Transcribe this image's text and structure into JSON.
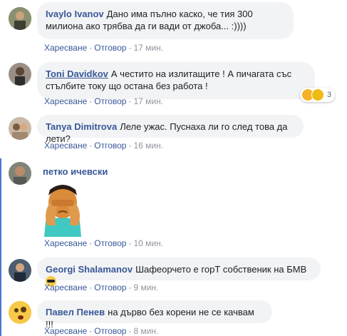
{
  "comments": [
    {
      "author": "Ivaylo Ivanov",
      "text": "Дано има пълно каско, че тия 300 милиона ако трябва да ги вади от джоба... :))))",
      "like": "Харесване",
      "reply": "Отговор",
      "time": "17 мин."
    },
    {
      "author": "Toni Davidkov",
      "text": "А честито на излитащите ! А пичагата със стълбите току що остана без работа !",
      "like": "Харесване",
      "reply": "Отговор",
      "time": "17 мин.",
      "reactions_count": "3"
    },
    {
      "author": "Tanya Dimitrova",
      "text": "Леле ужас. Пуснаха ли го след това да лети?",
      "like": "Харесване",
      "reply": "Отговор",
      "time": "16 мин."
    },
    {
      "author": "петко ичевски",
      "text": "",
      "like": "Харесване",
      "reply": "Отговор",
      "time": "10 мин."
    },
    {
      "author": "Georgi Shalamanov",
      "text": "Шафеорчето е горТ собственик на БМВ",
      "like": "Харесване",
      "reply": "Отговор",
      "time": "9 мин."
    },
    {
      "author": "Павел Пенев",
      "text": "на дърво без корени не се качвам !!!",
      "like": "Харесване",
      "reply": "Отговор",
      "time": "8 мин."
    }
  ],
  "sep": "·"
}
